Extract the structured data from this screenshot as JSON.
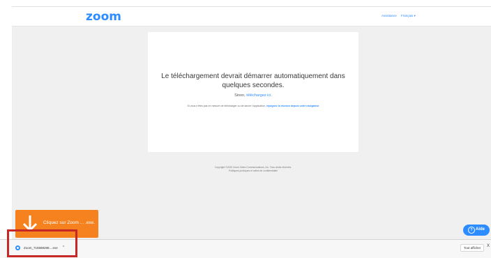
{
  "header": {
    "logo": "zoom",
    "nav_assistance": "Assistance",
    "nav_language": "Français ▾"
  },
  "main": {
    "headline": "Le téléchargement devrait démarrer automatiquement dans quelques secondes.",
    "sinon_prefix": "Sinon, ",
    "sinon_link": "téléchargez ici.",
    "help_text": "Si vous n'êtes pas en mesure de télécharger ou de lancer l'application, ",
    "help_link": "rejoignez la réunion depuis votre navigateur"
  },
  "footer": {
    "copyright": "Copyright ©2020 Zoom Video Communications, Inc. Tous droits réservés.",
    "policies": "Politiques juridiques et celles de confidentialité"
  },
  "toast": {
    "text": "Cliquez sur Zoom ... .exe."
  },
  "aide_button": {
    "label": "Aide",
    "icon_glyph": "?"
  },
  "download_bar": {
    "file_name": "Zoom_715588288....exe",
    "chevron": "^",
    "show_all": "Tout afficher",
    "close_glyph": "X"
  },
  "colors": {
    "brand_blue": "#2d8cff",
    "toast_orange": "#f5821f",
    "highlight_red": "#c62828"
  }
}
